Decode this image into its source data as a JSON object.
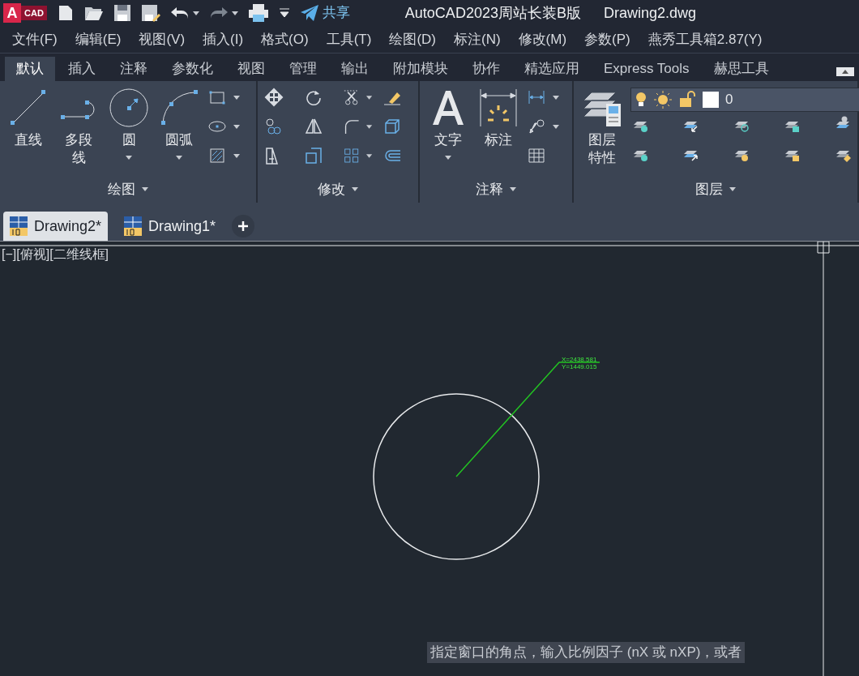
{
  "title_bar": {
    "app_letter": "A",
    "app_badge": "CAD",
    "share": "共享",
    "title": "AutoCAD2023周站长装B版",
    "file": "Drawing2.dwg"
  },
  "menu": [
    "文件(F)",
    "编辑(E)",
    "视图(V)",
    "插入(I)",
    "格式(O)",
    "工具(T)",
    "绘图(D)",
    "标注(N)",
    "修改(M)",
    "参数(P)",
    "燕秀工具箱2.87(Y)"
  ],
  "ribbon_tabs": [
    {
      "label": "默认",
      "selected": true
    },
    {
      "label": "插入",
      "selected": false
    },
    {
      "label": "注释",
      "selected": false
    },
    {
      "label": "参数化",
      "selected": false
    },
    {
      "label": "视图",
      "selected": false
    },
    {
      "label": "管理",
      "selected": false
    },
    {
      "label": "输出",
      "selected": false
    },
    {
      "label": "附加模块",
      "selected": false
    },
    {
      "label": "协作",
      "selected": false
    },
    {
      "label": "精选应用",
      "selected": false
    },
    {
      "label": "Express Tools",
      "selected": false
    },
    {
      "label": "赫思工具",
      "selected": false
    }
  ],
  "panels": [
    {
      "title": "绘图",
      "large_tools": [
        {
          "kind": "line",
          "label": "直线",
          "dropdown": false
        },
        {
          "kind": "polyline",
          "label": "多段线",
          "dropdown": false
        },
        {
          "kind": "circle",
          "label": "圆",
          "dropdown": true
        },
        {
          "kind": "arc",
          "label": "圆弧",
          "dropdown": true
        }
      ],
      "small_tools": [
        {
          "kind": "rectangle",
          "dropdown": true
        },
        {
          "kind": "ellipse",
          "dropdown": true
        },
        {
          "kind": "hatch",
          "dropdown": true
        }
      ]
    },
    {
      "title": "修改",
      "small_tools": [
        {
          "kind": "move",
          "dropdown": false
        },
        {
          "kind": "rotate",
          "dropdown": false
        },
        {
          "kind": "trim",
          "dropdown": true
        },
        {
          "kind": "erase",
          "dropdown": false
        },
        {
          "kind": "copy",
          "dropdown": false
        },
        {
          "kind": "mirror",
          "dropdown": false
        },
        {
          "kind": "fillet",
          "dropdown": true
        },
        {
          "kind": "box",
          "dropdown": false
        },
        {
          "kind": "stretch",
          "dropdown": false
        },
        {
          "kind": "scale",
          "dropdown": false
        },
        {
          "kind": "array",
          "dropdown": true
        },
        {
          "kind": "offset",
          "dropdown": false
        }
      ]
    },
    {
      "title": "注释",
      "large_tools": [
        {
          "kind": "text",
          "label": "文字",
          "dropdown": true
        },
        {
          "kind": "dimension",
          "label": "标注",
          "dropdown": false
        }
      ],
      "small_tools": [
        {
          "kind": "linear",
          "dropdown": true
        },
        {
          "kind": "leader",
          "dropdown": true
        },
        {
          "kind": "table",
          "dropdown": false
        }
      ]
    },
    {
      "title": "图层",
      "large_tools": [
        {
          "kind": "layers",
          "label": "图层特性",
          "dropdown": false
        }
      ],
      "layer_control": {
        "name": "0"
      },
      "small_tools": [
        {
          "kind": "layer-bulb",
          "dropdown": false
        },
        {
          "kind": "layer-down",
          "dropdown": false
        },
        {
          "kind": "layer-snow",
          "dropdown": false
        },
        {
          "kind": "layer-lock",
          "dropdown": false
        },
        {
          "kind": "layer-person",
          "dropdown": false
        },
        {
          "kind": "layer-bulb",
          "dropdown": false
        },
        {
          "kind": "layer-up",
          "dropdown": false
        },
        {
          "kind": "layer-sun",
          "dropdown": false
        },
        {
          "kind": "layer-unlock",
          "dropdown": false
        },
        {
          "kind": "layer-erase",
          "dropdown": false
        }
      ]
    }
  ],
  "doc_tabs": [
    {
      "label": "Drawing2*",
      "selected": true
    },
    {
      "label": "Drawing1*",
      "selected": false
    }
  ],
  "viewport_label": "[−][俯视][二维线框]",
  "coordinates": {
    "x": "X=2438.581",
    "y": "Y=1449.015"
  },
  "command_prompt": "指定窗口的角点，输入比例因子 (nX 或 nXP)，或者"
}
